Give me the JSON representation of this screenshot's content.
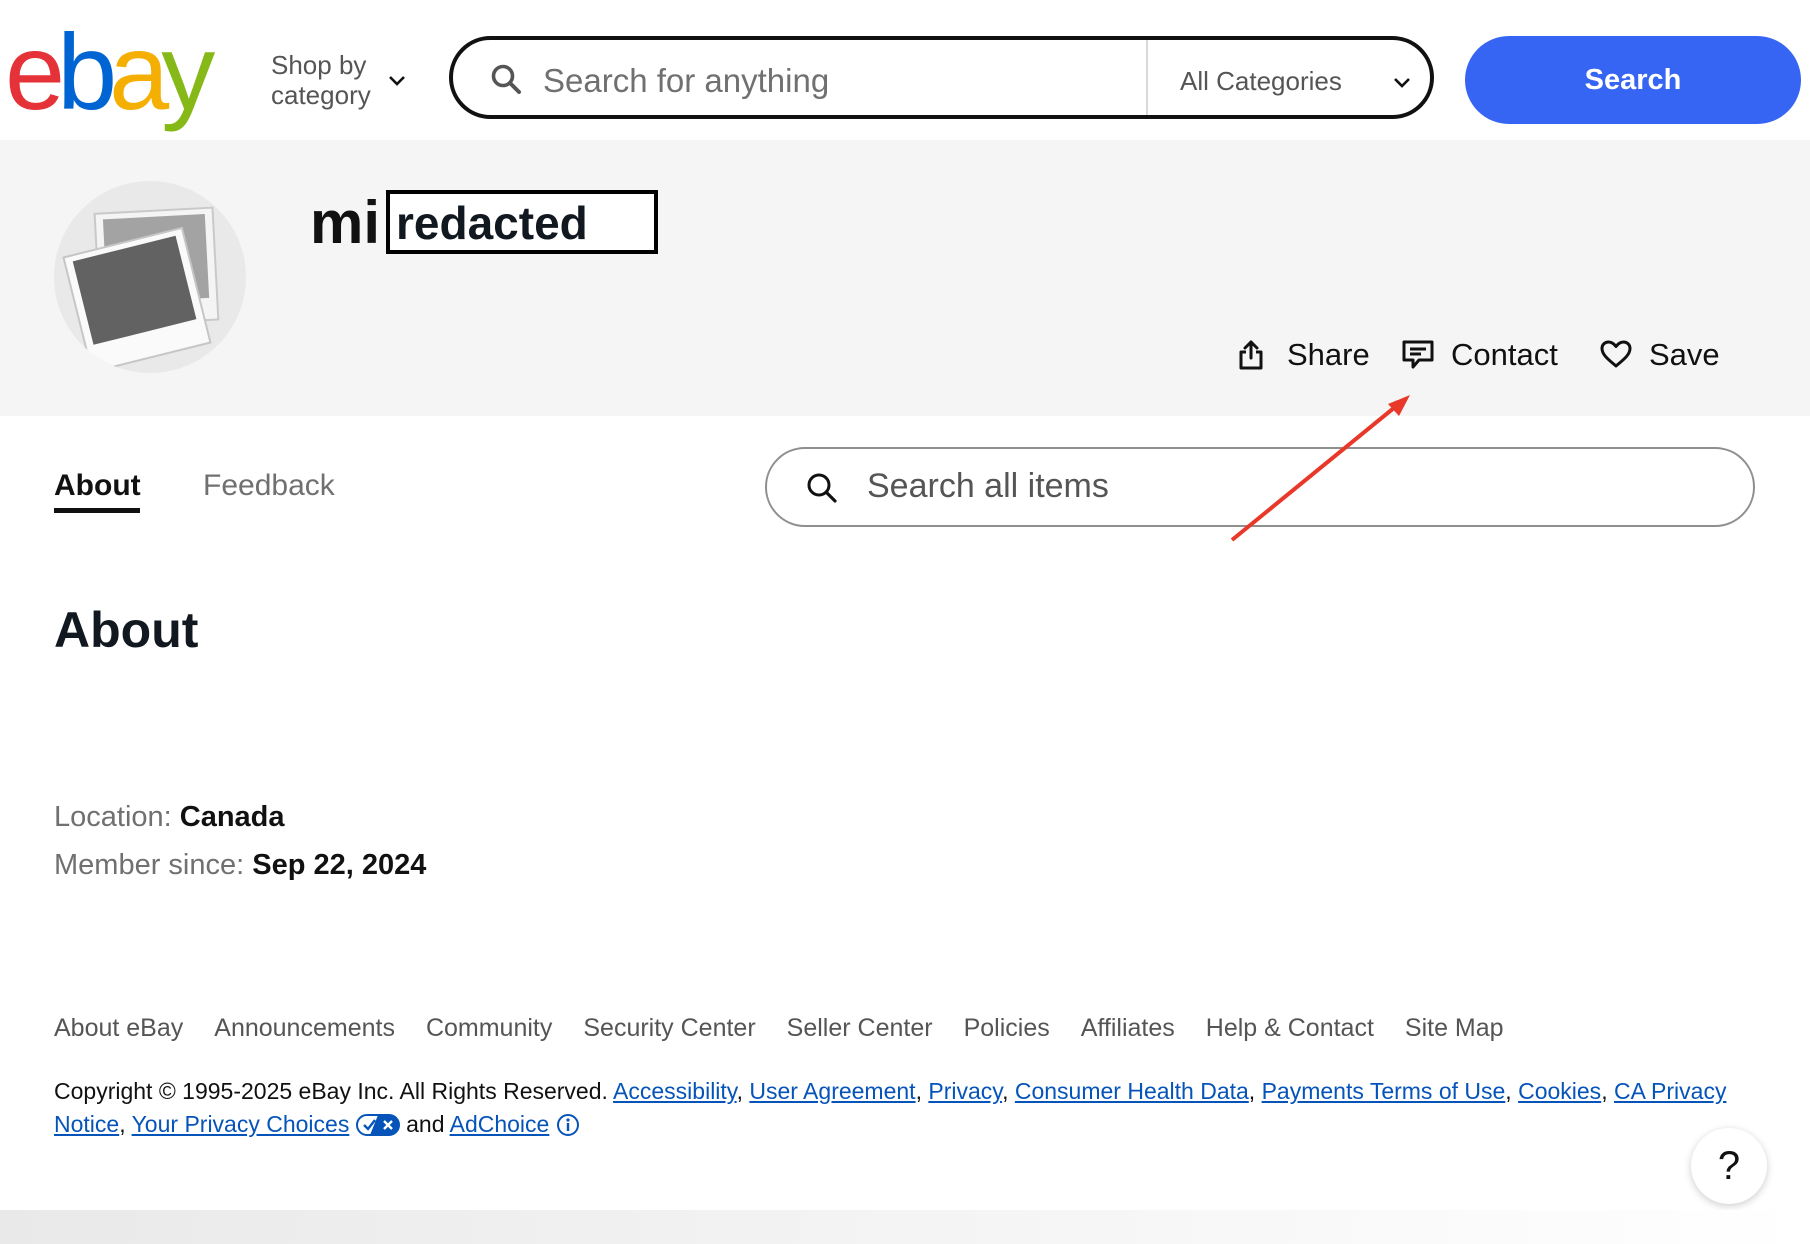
{
  "header": {
    "logo": [
      "e",
      "b",
      "a",
      "y"
    ],
    "logo_colors": [
      "#e53238",
      "#0064d2",
      "#f5af02",
      "#86b817"
    ],
    "shop_by_category": "Shop by category",
    "search_placeholder": "Search for anything",
    "category_select": "All Categories",
    "search_button": "Search"
  },
  "profile": {
    "username_prefix": "mi",
    "username_redacted": "redacted",
    "actions": {
      "share": "Share",
      "contact": "Contact",
      "save": "Save"
    }
  },
  "tabs": {
    "about": "About",
    "feedback": "Feedback"
  },
  "item_search": {
    "placeholder": "Search all items"
  },
  "about": {
    "heading": "About",
    "location_label": "Location:",
    "location_value": "Canada",
    "member_since_label": "Member since:",
    "member_since_value": "Sep 22, 2024"
  },
  "footer": {
    "links": [
      "About eBay",
      "Announcements",
      "Community",
      "Security Center",
      "Seller Center",
      "Policies",
      "Affiliates",
      "Help & Contact",
      "Site Map"
    ],
    "copyright_text": "Copyright © 1995-2025 eBay Inc. All Rights Reserved.",
    "legal_links": [
      "Accessibility",
      "User Agreement",
      "Privacy",
      "Consumer Health Data",
      "Payments Terms of Use",
      "Cookies",
      "CA Privacy Notice",
      "Your Privacy Choices"
    ],
    "and_text": "and",
    "adchoice": "AdChoice"
  },
  "help_button": "?",
  "annotation": {
    "arrow_color": "#e8382a"
  }
}
